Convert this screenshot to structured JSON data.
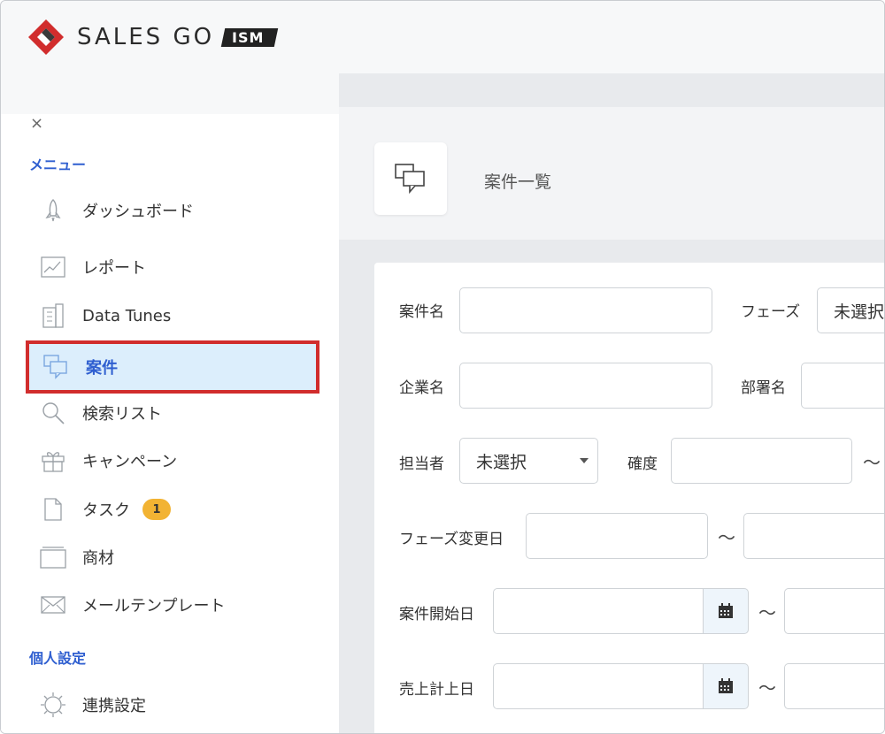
{
  "header": {
    "logo_text": "SALES GO",
    "logo_badge": "ISM"
  },
  "sidebar": {
    "close_symbol": "×",
    "menu_title": "メニュー",
    "items": [
      {
        "label": "ダッシュボード",
        "icon": "rocket-icon"
      },
      {
        "label": "レポート",
        "icon": "line-chart-icon"
      },
      {
        "label": "Data Tunes",
        "icon": "building-icon"
      },
      {
        "label": "案件",
        "icon": "chat-bubbles-icon",
        "active": true
      },
      {
        "label": "検索リスト",
        "icon": "search-icon"
      },
      {
        "label": "キャンペーン",
        "icon": "gift-icon"
      },
      {
        "label": "タスク",
        "icon": "document-icon",
        "badge": "1"
      },
      {
        "label": "商材",
        "icon": "folder-icon"
      },
      {
        "label": "メールテンプレート",
        "icon": "envelope-icon"
      }
    ],
    "personal_title": "個人設定",
    "personal_items": [
      {
        "label": "連携設定",
        "icon": "gear-icon"
      }
    ]
  },
  "main": {
    "page_title": "案件一覧",
    "page_icon": "chat-bubbles-icon",
    "form": {
      "deal_name_label": "案件名",
      "phase_label": "フェーズ",
      "phase_value": "未選択",
      "company_label": "企業名",
      "department_label": "部署名",
      "owner_label": "担当者",
      "owner_value": "未選択",
      "certainty_label": "確度",
      "phase_change_date_label": "フェーズ変更日",
      "start_date_label": "案件開始日",
      "sales_date_label": "売上計上日",
      "range_separator": "〜"
    }
  },
  "colors": {
    "accent_blue": "#2f5fd0",
    "highlight_red": "#d12d2d",
    "active_bg": "#dceefc",
    "badge_yellow": "#f2b333",
    "logo_red": "#d12d2d"
  }
}
